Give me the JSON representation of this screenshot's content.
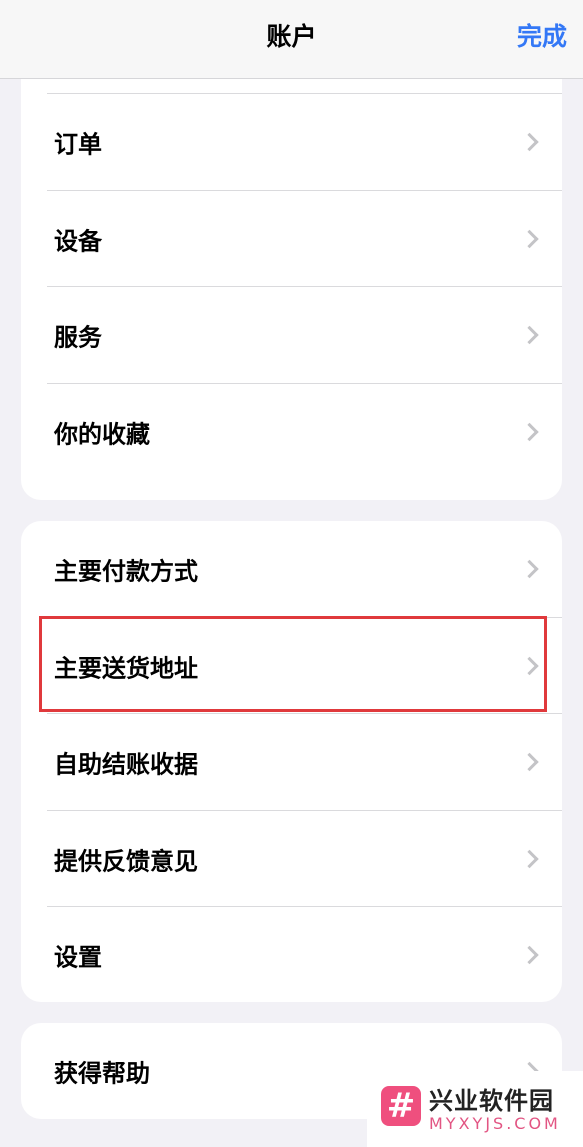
{
  "nav": {
    "title": "账户",
    "done": "完成"
  },
  "group1": {
    "items": [
      {
        "label": "订单"
      },
      {
        "label": "设备"
      },
      {
        "label": "服务"
      },
      {
        "label": "你的收藏"
      }
    ]
  },
  "group2": {
    "items": [
      {
        "label": "主要付款方式"
      },
      {
        "label": "主要送货地址",
        "highlighted": true
      },
      {
        "label": "自助结账收据"
      },
      {
        "label": "提供反馈意见"
      },
      {
        "label": "设置"
      }
    ]
  },
  "group3": {
    "items": [
      {
        "label": "获得帮助"
      }
    ]
  },
  "watermark": {
    "name": "兴业软件园",
    "url": "MYXYJS.COM",
    "logo_glyph": "#",
    "logo_color": "#ef4f7e"
  },
  "colors": {
    "accent": "#3478f6",
    "highlight": "#e0393c",
    "background": "#f2f1f6"
  },
  "icons": {
    "row_chevron": "chevron-right-icon"
  }
}
